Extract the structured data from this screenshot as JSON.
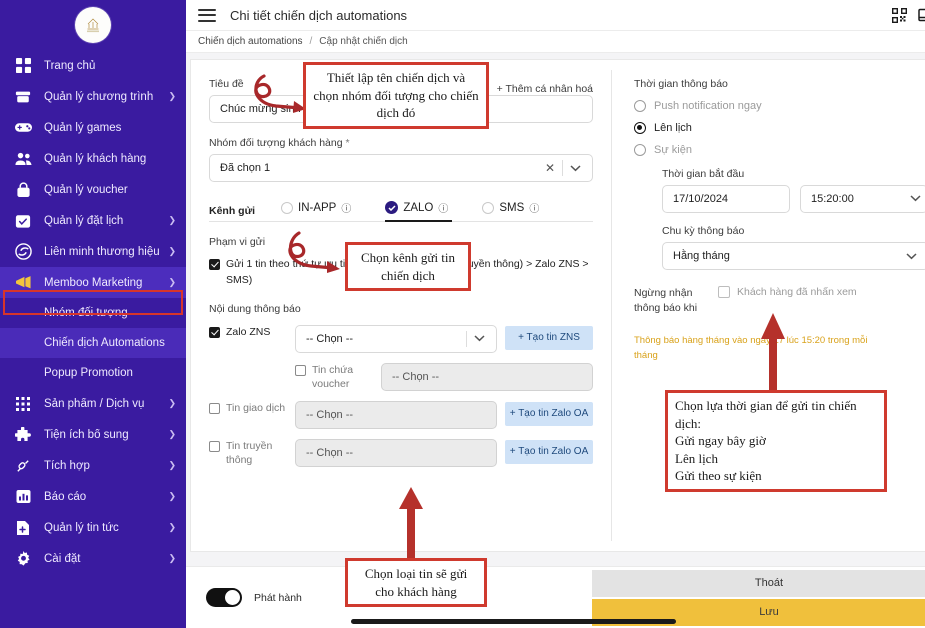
{
  "colors": {
    "sidebar_bg": "#3a1ba0",
    "sidebar_active": "#4c2dbd",
    "annotation_red": "#cf3a2e",
    "save_yellow": "#f0c03c",
    "warning_orange": "#d9a21b",
    "zalo_navy": "#2b1b80",
    "button_blue_bg": "#cfe2f7"
  },
  "sidebar": {
    "logo_alt": "brand-logo",
    "items": [
      {
        "label": "Trang chủ",
        "icon": "grid-icon",
        "chevron": false
      },
      {
        "label": "Quản lý chương trình",
        "icon": "box-icon",
        "chevron": true
      },
      {
        "label": "Quản lý games",
        "icon": "gamepad-icon",
        "chevron": false
      },
      {
        "label": "Quản lý khách hàng",
        "icon": "users-icon",
        "chevron": false
      },
      {
        "label": "Quản lý voucher",
        "icon": "bag-icon",
        "chevron": false
      },
      {
        "label": "Quản lý đặt lịch",
        "icon": "calendar-check-icon",
        "chevron": true
      },
      {
        "label": "Liên minh thương hiệu",
        "icon": "handshake-icon",
        "chevron": true
      },
      {
        "label": "Memboo Marketing",
        "icon": "megaphone-icon",
        "chevron": true,
        "active": true
      }
    ],
    "sub_items": [
      {
        "label": "Nhóm đối tượng"
      },
      {
        "label": "Chiến dịch Automations",
        "highlighted": true
      },
      {
        "label": "Popup Promotion"
      }
    ],
    "items_bottom": [
      {
        "label": "Sản phẩm / Dịch vụ",
        "icon": "apps-grid-icon",
        "chevron": true
      },
      {
        "label": "Tiện ích bổ sung",
        "icon": "puzzle-icon",
        "chevron": true
      },
      {
        "label": "Tích hợp",
        "icon": "plug-icon",
        "chevron": true
      },
      {
        "label": "Báo cáo",
        "icon": "chart-bar-icon",
        "chevron": true
      },
      {
        "label": "Quản lý tin tức",
        "icon": "file-plus-icon",
        "chevron": true
      },
      {
        "label": "Cài đặt",
        "icon": "gear-icon",
        "chevron": true
      }
    ]
  },
  "topbar": {
    "title": "Chi tiết chiến dịch automations",
    "icons": [
      "qr-code-icon",
      "monitor-icon"
    ]
  },
  "breadcrumb": {
    "root": "Chiến dịch automations",
    "separator": "/",
    "current": "Cập nhật chiến dịch"
  },
  "form": {
    "title_label": "Tiêu đề",
    "title_value": "Chúc mừng sinh nhật",
    "personalize_link": "+ Thêm cá nhân hoá",
    "audience_label": "Nhóm đối tượng khách hàng",
    "audience_required": "*",
    "audience_value": "Đã chọn 1",
    "channel_label": "Kênh gửi",
    "channels": [
      {
        "label": "IN-APP",
        "selected": false
      },
      {
        "label": "ZALO",
        "selected": true
      },
      {
        "label": "SMS",
        "selected": false
      }
    ],
    "scope_label": "Phạm vi gửi",
    "scope_checkbox": "Gửi 1 tin theo thứ tự ưu tiên (Zalo OA( Giao dịch, Truyền thông) > Zalo ZNS > SMS)",
    "content_label": "Nội dung thông báo",
    "message_rows": [
      {
        "name": "Zalo ZNS",
        "checked": true,
        "dim": false,
        "select_value": "-- Chọn --",
        "select_disabled": false,
        "button": "+ Tạo tin ZNS",
        "indent": false
      },
      {
        "name": "Tin chứa voucher",
        "checked": false,
        "dim": true,
        "select_value": "-- Chọn --",
        "select_disabled": true,
        "button": "",
        "indent": true
      },
      {
        "name": "Tin giao dịch",
        "checked": false,
        "dim": true,
        "select_value": "-- Chọn --",
        "select_disabled": true,
        "button": "+ Tạo tin Zalo OA",
        "indent": false
      },
      {
        "name": "Tin truyền thông",
        "checked": false,
        "dim": true,
        "select_value": "-- Chọn --",
        "select_disabled": true,
        "button": "+ Tạo tin Zalo OA",
        "indent": false
      }
    ]
  },
  "schedule": {
    "title": "Thời gian thông báo",
    "options": [
      {
        "label": "Push notification ngay",
        "selected": false,
        "dim": true
      },
      {
        "label": "Lên lịch",
        "selected": true,
        "dim": false
      },
      {
        "label": "Sự kiện",
        "selected": false,
        "dim": true
      }
    ],
    "start_label": "Thời gian bắt đầu",
    "start_date": "17/10/2024",
    "start_time": "15:20:00",
    "cycle_label": "Chu kỳ thông báo",
    "cycle_value": "Hằng tháng",
    "stop_label": "Ngừng nhận thông báo khi",
    "stop_checkbox": "Khách hàng đã nhấn xem",
    "warning": "Thông báo hàng tháng vào ngày 17 lúc 15:20 trong mỗi tháng"
  },
  "footer": {
    "toggle_label": "Phát hành",
    "toggle_on": true,
    "exit_button": "Thoát",
    "save_button": "Lưu"
  },
  "annotations": [
    {
      "id": "anno-title",
      "text": "Thiết lập tên chiến dịch và chọn nhóm đối tượng cho chiến dịch đó"
    },
    {
      "id": "anno-channel",
      "text": "Chọn kênh gửi tin chiến dịch"
    },
    {
      "id": "anno-schedule",
      "text": "Chọn lựa thời gian để gửi tin chiến dịch:\nGửi ngay bây giờ\nLên lịch\nGửi theo sự kiện"
    },
    {
      "id": "anno-message-type",
      "text": "Chọn loại tin sẽ gửi cho khách hàng"
    }
  ]
}
